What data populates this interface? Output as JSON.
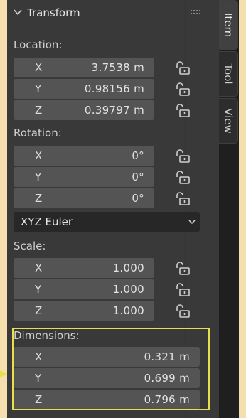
{
  "panel": {
    "title": "Transform",
    "colors": {
      "panel_bg": "#393939",
      "field_bg": "#545454",
      "dropdown_bg": "#272727",
      "highlight": "#e8e04a",
      "page_bg": "#f5dfae"
    }
  },
  "tabs": [
    {
      "label": "Item",
      "active": true
    },
    {
      "label": "Tool",
      "active": false
    },
    {
      "label": "View",
      "active": false
    }
  ],
  "location": {
    "label": "Location:",
    "rows": [
      {
        "axis": "X",
        "value": "3.7538 m"
      },
      {
        "axis": "Y",
        "value": "0.98156 m"
      },
      {
        "axis": "Z",
        "value": "0.39797 m"
      }
    ]
  },
  "rotation": {
    "label": "Rotation:",
    "rows": [
      {
        "axis": "X",
        "value": "0°"
      },
      {
        "axis": "Y",
        "value": "0°"
      },
      {
        "axis": "Z",
        "value": "0°"
      }
    ],
    "mode": "XYZ Euler"
  },
  "scale": {
    "label": "Scale:",
    "rows": [
      {
        "axis": "X",
        "value": "1.000"
      },
      {
        "axis": "Y",
        "value": "1.000"
      },
      {
        "axis": "Z",
        "value": "1.000"
      }
    ]
  },
  "dimensions": {
    "label": "Dimensions:",
    "rows": [
      {
        "axis": "X",
        "value": "0.321 m"
      },
      {
        "axis": "Y",
        "value": "0.699 m"
      },
      {
        "axis": "Z",
        "value": "0.796 m"
      }
    ]
  },
  "icons": {
    "collapse": "chevron-down-icon",
    "drag": "drag-grip-icon",
    "lock": "lock-open-icon",
    "dropdown": "chevron-down-icon"
  }
}
